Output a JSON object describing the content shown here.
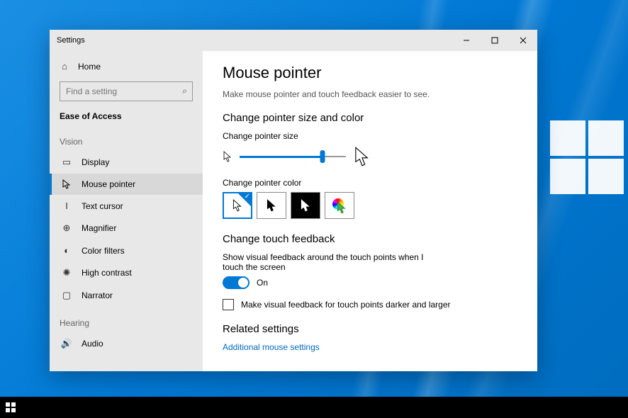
{
  "window": {
    "title": "Settings"
  },
  "sidebar": {
    "home_label": "Home",
    "search_placeholder": "Find a setting",
    "category": "Ease of Access",
    "groups": {
      "vision": "Vision",
      "hearing": "Hearing"
    },
    "items": {
      "display": "Display",
      "mouse_pointer": "Mouse pointer",
      "text_cursor": "Text cursor",
      "magnifier": "Magnifier",
      "color_filters": "Color filters",
      "high_contrast": "High contrast",
      "narrator": "Narrator",
      "audio": "Audio"
    }
  },
  "content": {
    "title": "Mouse pointer",
    "subtitle": "Make mouse pointer and touch feedback easier to see.",
    "section_size_color": "Change pointer size and color",
    "label_size": "Change pointer size",
    "label_color": "Change pointer color",
    "section_touch": "Change touch feedback",
    "touch_toggle_label": "Show visual feedback around the touch points when I touch the screen",
    "touch_toggle_state": "On",
    "touch_checkbox_label": "Make visual feedback for touch points darker and larger",
    "section_related": "Related settings",
    "related_link": "Additional mouse settings"
  }
}
